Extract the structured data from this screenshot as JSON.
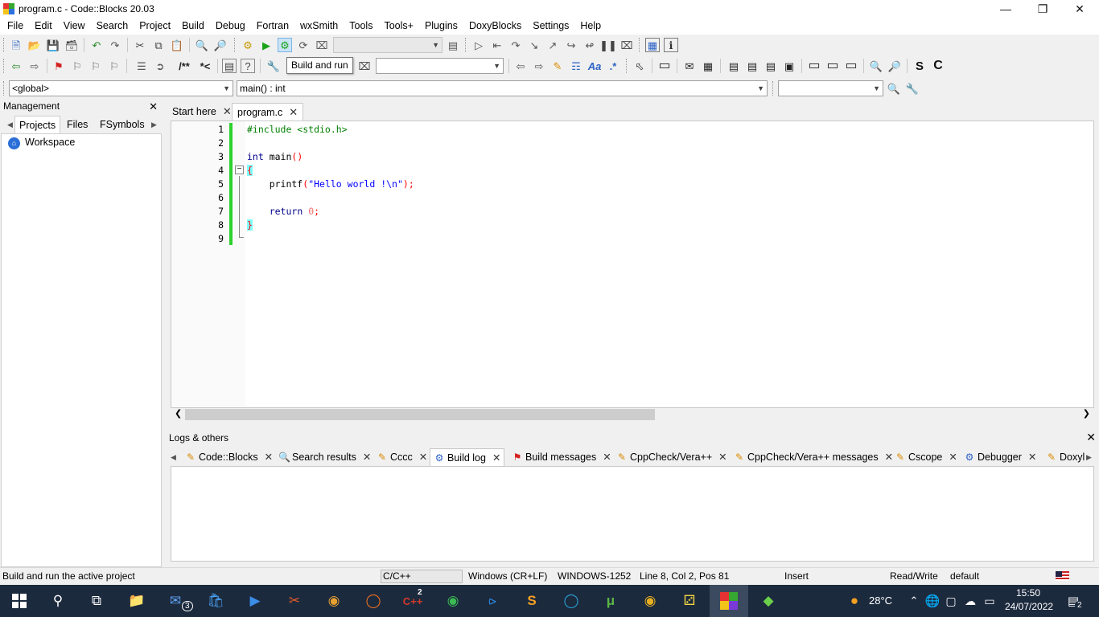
{
  "window": {
    "title": "program.c - Code::Blocks 20.03"
  },
  "menu": [
    "File",
    "Edit",
    "View",
    "Search",
    "Project",
    "Build",
    "Debug",
    "Fortran",
    "wxSmith",
    "Tools",
    "Tools+",
    "Plugins",
    "DoxyBlocks",
    "Settings",
    "Help"
  ],
  "toolbar": {
    "tooltip": "Build and run",
    "scope_combo": "<global>",
    "function_combo": "main() : int"
  },
  "management": {
    "title": "Management",
    "tabs": [
      "Projects",
      "Files",
      "FSymbols"
    ],
    "workspace_label": "Workspace"
  },
  "editor": {
    "tabs": [
      "Start here",
      "program.c"
    ],
    "line_numbers": [
      "1",
      "2",
      "3",
      "4",
      "5",
      "6",
      "7",
      "8",
      "9"
    ]
  },
  "logs": {
    "title": "Logs & others",
    "tabs": [
      "Code::Blocks",
      "Search results",
      "Cccc",
      "Build log",
      "Build messages",
      "CppCheck/Vera++",
      "CppCheck/Vera++ messages",
      "Cscope",
      "Debugger",
      "Doxyl"
    ]
  },
  "statusbar": {
    "message": "Build and run the active project",
    "language": "C/C++",
    "eol": "Windows (CR+LF)",
    "encoding": "WINDOWS-1252",
    "position": "Line 8, Col 2, Pos 81",
    "mode": "Insert",
    "access": "Read/Write",
    "profile": "default"
  },
  "taskbar": {
    "mail_badge": "3",
    "devcpp_badge": "2",
    "weather": "28°C",
    "time": "15:50",
    "date": "24/07/2022",
    "notifications": "2"
  },
  "colors": {
    "change_bar": "#2fd12f",
    "brace_highlight": "#80ffff",
    "keyword": "#00008b",
    "preprocessor": "#008000",
    "string": "#0000ff",
    "taskbar": "#1c2a3e"
  }
}
